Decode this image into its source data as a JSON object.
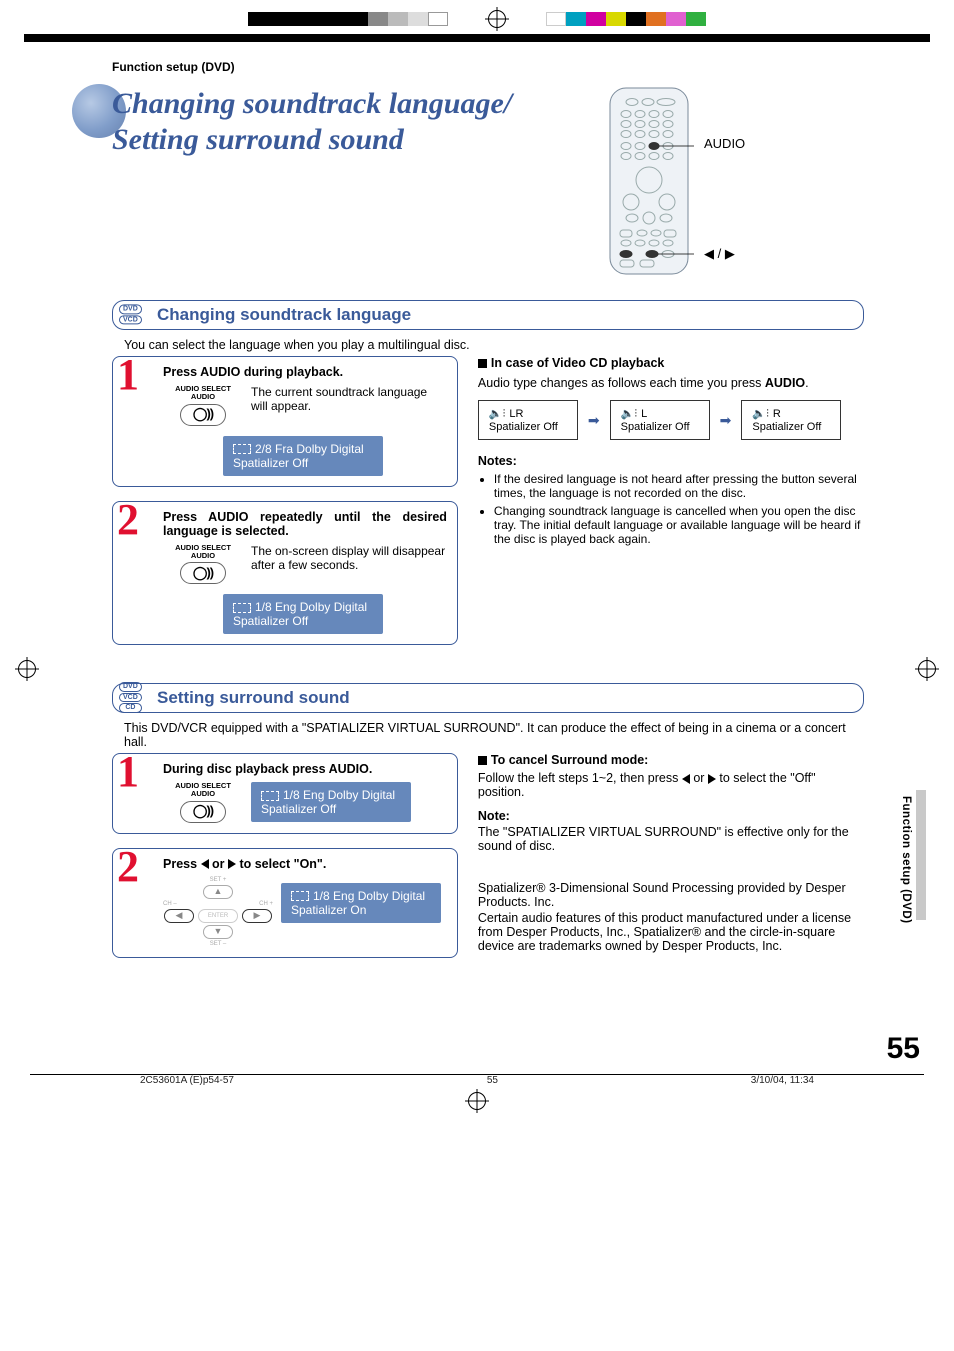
{
  "header": {
    "section_label": "Function setup (DVD)"
  },
  "title": {
    "line1": "Changing soundtrack language/",
    "line2": "Setting surround sound"
  },
  "remote_callouts": {
    "audio": "AUDIO",
    "arrows": "◀ / ▶"
  },
  "section1": {
    "badge_dvd": "DVD",
    "badge_vcd": "VCD",
    "heading": "Changing soundtrack language",
    "intro": "You can select the language when you play a multilingual disc.",
    "step1_title": "Press AUDIO during playback.",
    "step1_btn_l1": "AUDIO SELECT",
    "step1_btn_l2": "AUDIO",
    "step1_body": "The current soundtrack language will appear.",
    "step1_osd_l1": "2/8 Fra Dolby Digital",
    "step1_osd_l2": "Spatializer Off",
    "step2_title": "Press AUDIO repeatedly until the desired language is selected.",
    "step2_body": "The on-screen display will disappear after a few seconds.",
    "step2_osd_l1": "1/8 Eng Dolby Digital",
    "step2_osd_l2": "Spatializer Off",
    "right_h1": "In case of Video CD playback",
    "right_p1_a": "Audio type changes as follows each time you press ",
    "right_p1_b": "AUDIO",
    "right_p1_c": ".",
    "vcd_box1_l1": "LR",
    "vcd_box1_l2": "Spatializer Off",
    "vcd_box2_l1": "L",
    "vcd_box2_l2": "Spatializer Off",
    "vcd_box3_l1": "R",
    "vcd_box3_l2": "Spatializer Off",
    "notes_label": "Notes:",
    "note1": "If the desired language is not heard after pressing the button several times, the language is not recorded on the disc.",
    "note2": "Changing soundtrack language is cancelled when you open the disc tray. The initial default language or available language will be heard if the disc is played back again."
  },
  "section2": {
    "badge_dvd": "DVD",
    "badge_vcd": "VCD",
    "badge_cd": "CD",
    "heading": "Setting surround sound",
    "intro": "This DVD/VCR equipped with a \"SPATIALIZER VIRTUAL SURROUND\". It can produce the effect of being in a cinema or a concert hall.",
    "step1_title": "During disc playback press AUDIO.",
    "step1_osd_l1": "1/8 Eng Dolby Digital",
    "step1_osd_l2": "Spatializer Off",
    "step2_title_a": "Press ",
    "step2_title_b": " or ",
    "step2_title_c": " to select \"On\".",
    "step2_osd_l1": "1/8 Eng Dolby Digital",
    "step2_osd_l2": "Spatializer On",
    "nav_set_plus": "SET +",
    "nav_set_minus": "SET –",
    "nav_ch_minus": "CH –",
    "nav_ch_plus": "CH +",
    "nav_enter": "ENTER",
    "right_h1": "To cancel Surround mode",
    "right_p1_a": "Follow the left steps 1~2, then press ",
    "right_p1_b": " or ",
    "right_p1_c": " to select the \"Off\" position.",
    "right_note_label": "Note:",
    "right_note": "The \"SPATIALIZER VIRTUAL SURROUND\" is effective only for the sound of disc.",
    "legal_p1": "Spatializer® 3-Dimensional Sound Processing provided by Desper Products. Inc.",
    "legal_p2": "Certain audio features of this product manufactured under a license from Desper Products, Inc., Spatializer® and the circle-in-square device are trademarks owned by Desper Products, Inc."
  },
  "side_tab": "Function setup (DVD)",
  "page_number": "55",
  "footer": {
    "left": "2C53601A (E)p54-57",
    "center": "55",
    "right": "3/10/04, 11:34"
  }
}
